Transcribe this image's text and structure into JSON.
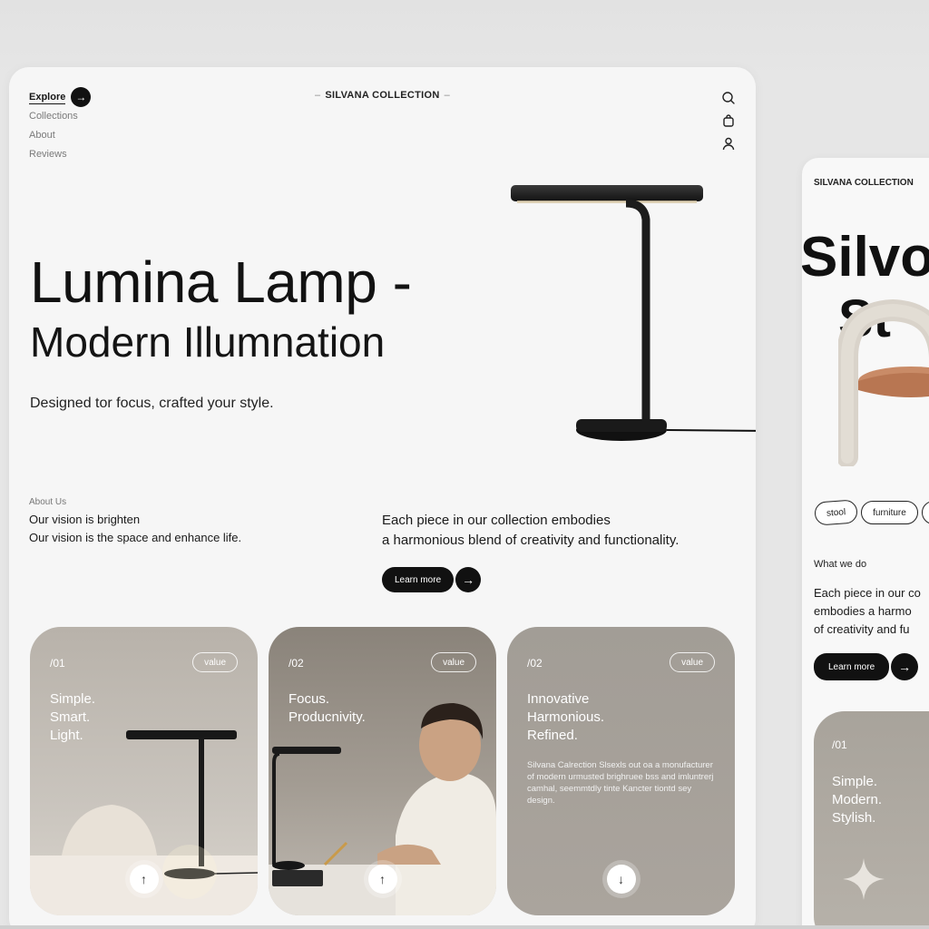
{
  "nav": {
    "items": [
      {
        "label": "Explore",
        "active": true
      },
      {
        "label": "Collections"
      },
      {
        "label": "About"
      },
      {
        "label": "Reviews"
      }
    ]
  },
  "brand": {
    "dash": "–",
    "name": "SILVANA COLLECTION"
  },
  "icons": {
    "search": "search-icon",
    "bag": "bag-icon",
    "user": "user-icon",
    "arrow": "arrow-right-icon"
  },
  "hero": {
    "title_line1": "Lumina Lamp -",
    "title_line2": "Modern Illumnation",
    "subtitle": "Designed tor focus, crafted your style."
  },
  "about": {
    "label": "About Us",
    "line1": "Our vision is brighten",
    "line2": "Our vision is the space and enhance life."
  },
  "description": {
    "line1": "Each piece in our collection embodies",
    "line2": "a harmonious blend of creativity and functionality."
  },
  "cta": {
    "label": "Learn more",
    "arrow": "→"
  },
  "cards": [
    {
      "num": "/01",
      "badge": "value",
      "title": "Simple.\nSmart.\nLight.",
      "button": "↑"
    },
    {
      "num": "/02",
      "badge": "value",
      "title": "Focus.\nProducnivity.",
      "button": "↑"
    },
    {
      "num": "/02",
      "badge": "value",
      "title": "Innovative\nHarmonious.\nRefined.",
      "body": "Silvana Calrection Slsexls out oa a monufacturer of modern urmusted brighruee bss and imluntrerj camhal, seemmtdly tinte Kancter tiontd sey design.",
      "button": "↓"
    }
  ],
  "side": {
    "brand": "SILVANA COLLECTION",
    "hero_line1": "Silvo",
    "hero_line2": "St",
    "tags": [
      "stool",
      "furniture",
      ""
    ],
    "what_label": "What we do",
    "desc_line1": "Each piece in our co",
    "desc_line2": "embodies a harmo",
    "desc_line3": "of creativity and fu",
    "cta_label": "Learn more",
    "cta_arrow": "→",
    "card_num": "/01",
    "card_title": "Simple.\nModern.\nStylish."
  },
  "colors": {
    "accent": "#111111",
    "background": "#f6f6f6",
    "card_warm": "#c9c4bd",
    "card_taupe": "#a9a39c"
  }
}
